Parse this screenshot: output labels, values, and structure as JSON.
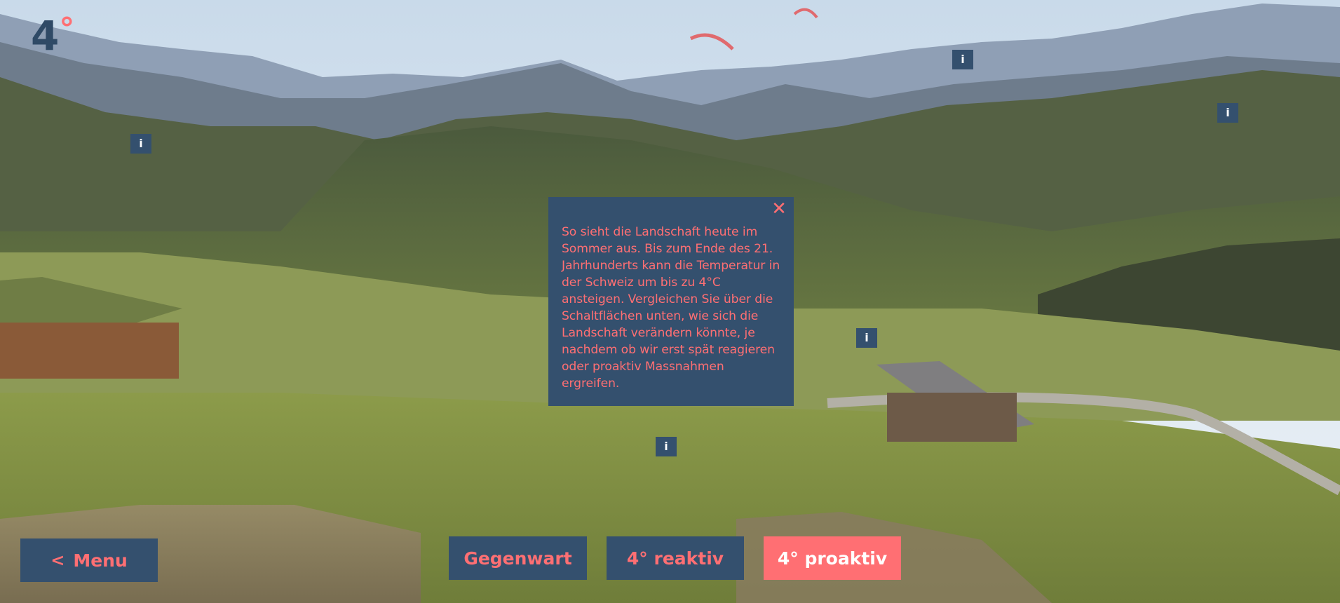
{
  "logo": {
    "number": "4",
    "degree": "°"
  },
  "hotspot_label": "i",
  "dialog": {
    "close_symbol": "✕",
    "text": "So sieht die Landschaft heute im Sommer aus. Bis zum Ende des 21. Jahrhunderts kann die Temperatur in der Schweiz um bis zu 4°C ansteigen. Vergleichen Sie über die Schaltflächen unten, wie sich die Landschaft verändern könnte, je nachdem ob wir erst spät reagieren oder proaktiv Massnahmen ergreifen."
  },
  "nav": {
    "menu_chevron": "<",
    "menu_label": "Menu",
    "scenarios": [
      "Gegenwart",
      "4° reaktiv",
      "4° proaktiv"
    ]
  },
  "colors": {
    "accent": "#ff6f73",
    "panel": "#34506e",
    "logo": "#2f4a66"
  }
}
